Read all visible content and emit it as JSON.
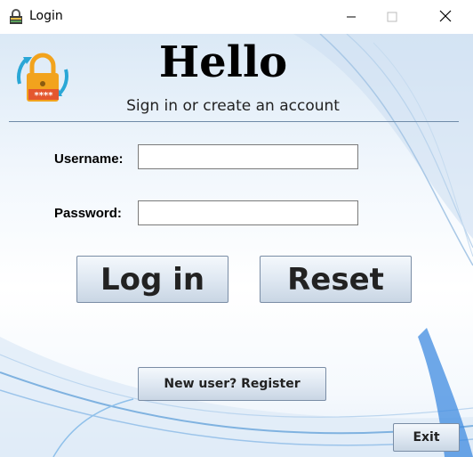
{
  "window": {
    "title": "Login",
    "icon": "padlock-icon",
    "controls": [
      "minimize-icon",
      "maximize-icon",
      "close-icon"
    ]
  },
  "header": {
    "greeting": "Hello",
    "subtitle": "Sign in or create an account",
    "logo_mask": "****",
    "logo_icon": "padlock-refresh-icon"
  },
  "form": {
    "username_label": "Username:",
    "username_value": "",
    "password_label": "Password:",
    "password_value": ""
  },
  "buttons": {
    "login": "Log in",
    "reset": "Reset",
    "register": "New user? Register",
    "exit": "Exit"
  },
  "colors": {
    "lock_body": "#f2a31d",
    "lock_plate": "#e4572e",
    "arrows": "#2aa7d6",
    "button_border": "#7a8da5"
  }
}
